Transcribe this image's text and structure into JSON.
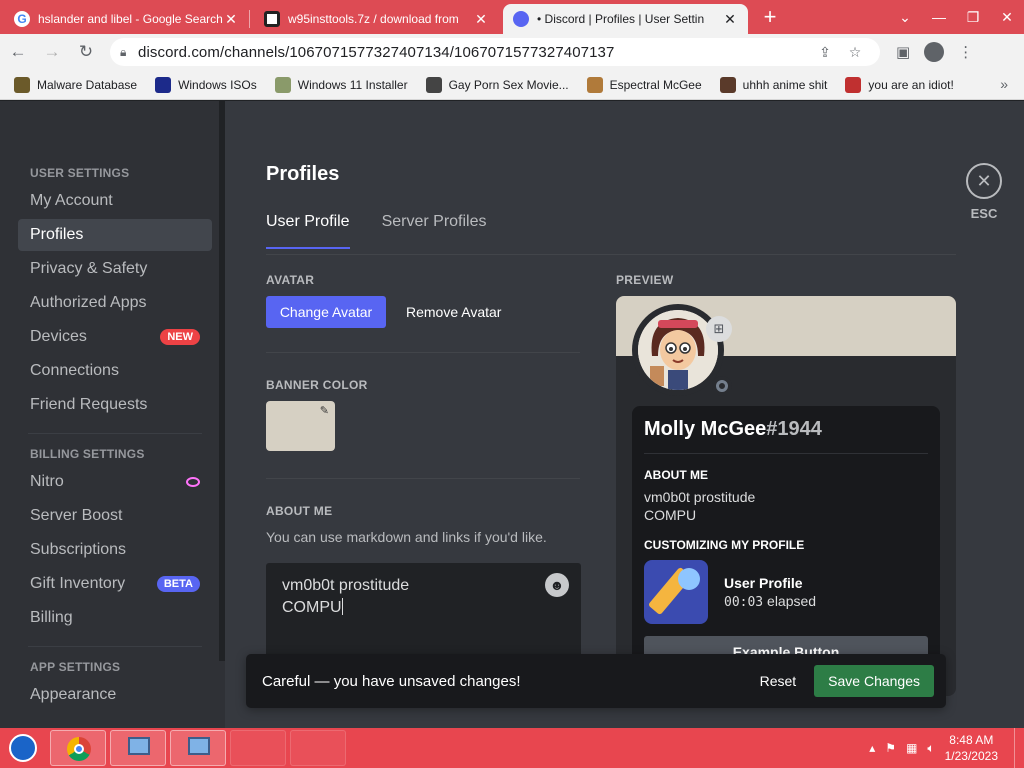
{
  "browser": {
    "tabs": [
      {
        "title": "hslander and libel - Google Search",
        "icon": "google-icon",
        "active": false
      },
      {
        "title": "w95insttools.7z / download from",
        "icon": "github-icon",
        "active": false
      },
      {
        "title": "• Discord | Profiles | User Settin",
        "icon": "discord-icon",
        "active": true
      }
    ],
    "url": "discord.com/channels/1067071577327407134/1067071577327407137",
    "bookmarks": [
      {
        "label": "Malware Database",
        "icon": "malware-icon",
        "color": "#6b5a2a"
      },
      {
        "label": "Windows ISOs",
        "icon": "windows-x-icon",
        "color": "#1c2a8a"
      },
      {
        "label": "Windows 11 Installer",
        "icon": "installer-icon",
        "color": "#8a9a6a"
      },
      {
        "label": "Gay Porn Sex Movie...",
        "icon": "face-icon",
        "color": "#444444"
      },
      {
        "label": "Espectral McGee",
        "icon": "character-icon",
        "color": "#b07a3a"
      },
      {
        "label": "uhhh anime shit",
        "icon": "anime-icon",
        "color": "#5a3a2a"
      },
      {
        "label": "you are an idiot!",
        "icon": "flag-icon",
        "color": "#c03030"
      }
    ]
  },
  "sidebar": {
    "user_settings_header": "User Settings",
    "user_items": [
      {
        "label": "My Account"
      },
      {
        "label": "Profiles",
        "active": true
      },
      {
        "label": "Privacy & Safety"
      },
      {
        "label": "Authorized Apps"
      },
      {
        "label": "Devices",
        "badge": "NEW"
      },
      {
        "label": "Connections"
      },
      {
        "label": "Friend Requests"
      }
    ],
    "billing_header": "Billing Settings",
    "billing_items": [
      {
        "label": "Nitro",
        "icon": "nitro-icon"
      },
      {
        "label": "Server Boost"
      },
      {
        "label": "Subscriptions"
      },
      {
        "label": "Gift Inventory",
        "badge": "BETA"
      },
      {
        "label": "Billing"
      }
    ],
    "app_header": "App Settings",
    "app_items": [
      {
        "label": "Appearance"
      }
    ]
  },
  "page": {
    "title": "Profiles",
    "tabs": [
      {
        "label": "User Profile",
        "active": true
      },
      {
        "label": "Server Profiles",
        "active": false
      }
    ],
    "avatar_label": "Avatar",
    "change_avatar": "Change Avatar",
    "remove_avatar": "Remove Avatar",
    "banner_color_label": "Banner Color",
    "banner_color": "#d6d0c3",
    "about_me_label": "About Me",
    "about_me_help": "You can use markdown and links if you'd like.",
    "about_me_lines": [
      "vm0b0t prostitude",
      "COMPU"
    ],
    "esc": "ESC"
  },
  "preview": {
    "label": "Preview",
    "username": "Molly McGee",
    "discriminator": "#1944",
    "about_header": "About Me",
    "about_lines": [
      "vm0b0t prostitude",
      "COMPU"
    ],
    "customizing_header": "Customizing My Profile",
    "activity_title": "User Profile",
    "activity_time": "00:03",
    "activity_suffix": " elapsed",
    "example_button": "Example Button"
  },
  "notice": {
    "message": "Careful — you have unsaved changes!",
    "reset": "Reset",
    "save": "Save Changes"
  },
  "taskbar": {
    "time": "8:48 AM",
    "date": "1/23/2023"
  },
  "colors": {
    "accent": "#5865f2",
    "save_green": "#2d7d46",
    "tab_strip": "#dd4b54",
    "taskbar": "#e8464f"
  }
}
